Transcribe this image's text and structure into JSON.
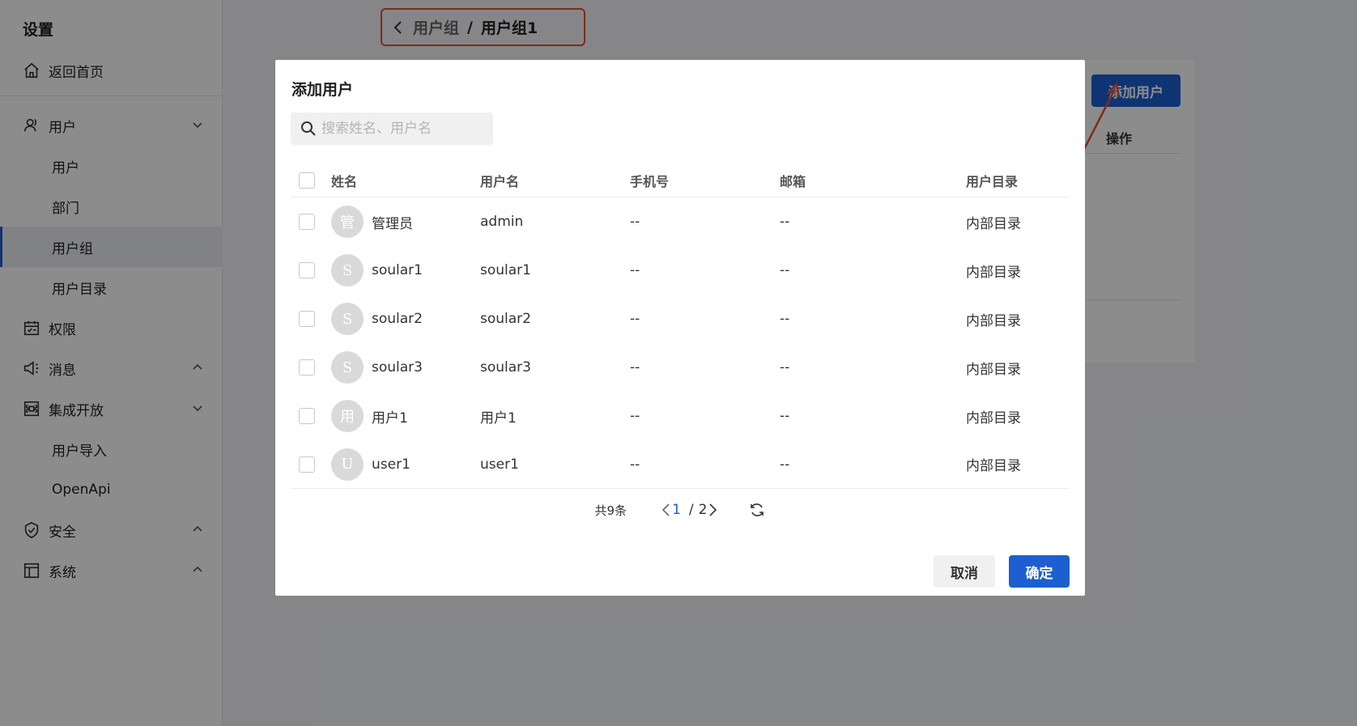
{
  "sidebar": {
    "title": "设置",
    "home": "返回首页",
    "items": [
      {
        "label": "用户",
        "icon": "user-icon"
      },
      {
        "label": "用户",
        "sub": true
      },
      {
        "label": "部门",
        "sub": true
      },
      {
        "label": "用户组",
        "sub": true,
        "active": true
      },
      {
        "label": "用户目录",
        "sub": true
      },
      {
        "label": "权限",
        "icon": "calendar-icon"
      },
      {
        "label": "消息",
        "icon": "megaphone-icon"
      },
      {
        "label": "集成开放",
        "icon": "command-icon"
      },
      {
        "label": "用户导入",
        "sub": true
      },
      {
        "label": "OpenApi",
        "sub": true
      },
      {
        "label": "安全",
        "icon": "shield-check-icon"
      },
      {
        "label": "系统",
        "icon": "layout-icon"
      }
    ]
  },
  "breadcrumb": {
    "parent": "用户组",
    "separator": "/",
    "current": "用户组1"
  },
  "background": {
    "add_user_button": "添加用户",
    "column_operation": "操作"
  },
  "modal": {
    "title": "添加用户",
    "search_placeholder": "搜索姓名、用户名",
    "columns": [
      "姓名",
      "用户名",
      "手机号",
      "邮箱",
      "用户目录"
    ],
    "rows": [
      {
        "avatar": "管",
        "name": "管理员",
        "username": "admin",
        "phone": "--",
        "email": "--",
        "directory": "内部目录"
      },
      {
        "avatar": "S",
        "name": "soular1",
        "username": "soular1",
        "phone": "--",
        "email": "--",
        "directory": "内部目录"
      },
      {
        "avatar": "S",
        "name": "soular2",
        "username": "soular2",
        "phone": "--",
        "email": "--",
        "directory": "内部目录"
      },
      {
        "avatar": "S",
        "name": "soular3",
        "username": "soular3",
        "phone": "--",
        "email": "--",
        "directory": "内部目录"
      },
      {
        "avatar": "用",
        "name": "用户1",
        "username": "用户1",
        "phone": "--",
        "email": "--",
        "directory": "内部目录"
      },
      {
        "avatar": "U",
        "name": "user1",
        "username": "user1",
        "phone": "--",
        "email": "--",
        "directory": "内部目录"
      }
    ],
    "pagination": {
      "total": "共9条",
      "current": "1",
      "separator": "/",
      "pages": "2"
    },
    "cancel_label": "取消",
    "confirm_label": "确定"
  },
  "colors": {
    "primary": "#1d5fd1",
    "annotation": "#e8502e"
  }
}
